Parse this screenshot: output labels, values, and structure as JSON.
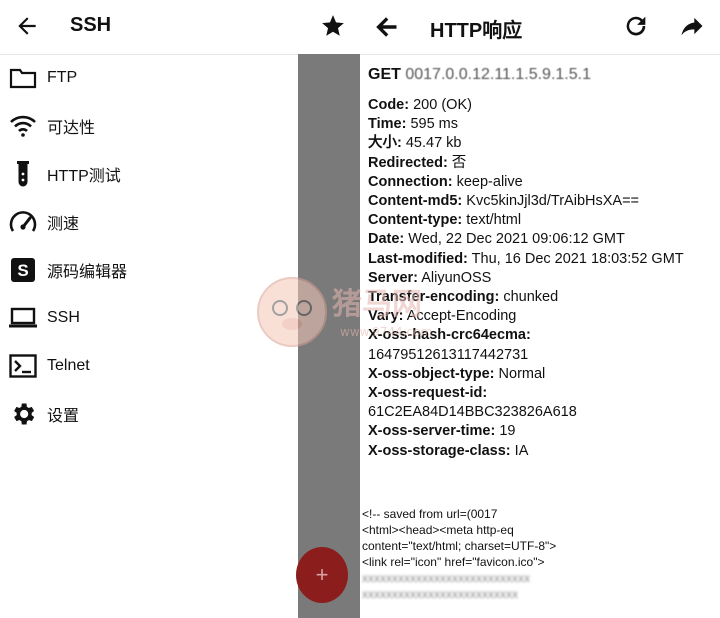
{
  "left": {
    "title": "SSH",
    "menu": [
      {
        "label": "FTP",
        "icon": "folder-icon"
      },
      {
        "label": "可达性",
        "icon": "wifi-icon"
      },
      {
        "label": "HTTP测试",
        "icon": "test-tube-icon"
      },
      {
        "label": "测速",
        "icon": "speedometer-icon"
      },
      {
        "label": "源码编辑器",
        "icon": "source-s-icon"
      },
      {
        "label": "SSH",
        "icon": "laptop-icon"
      },
      {
        "label": "Telnet",
        "icon": "terminal-icon"
      },
      {
        "label": "设置",
        "icon": "gear-icon"
      }
    ],
    "fab_label": "+"
  },
  "right": {
    "title": "HTTP响应",
    "request": {
      "method": "GET",
      "url": "0017.0.0.12.11.1.5.9.1.5.1"
    },
    "headers": [
      {
        "k": "Code:",
        "v": " 200 (OK)"
      },
      {
        "k": "Time:",
        "v": " 595 ms"
      },
      {
        "k": "大小:",
        "v": " 45.47 kb"
      },
      {
        "k": "Redirected:",
        "v": " 否"
      },
      {
        "k": "Connection:",
        "v": " keep-alive"
      },
      {
        "k": "Content-md5:",
        "v": " Kvc5kinJjl3d/TrAibHsXA=="
      },
      {
        "k": "Content-type:",
        "v": " text/html"
      },
      {
        "k": "Date:",
        "v": " Wed, 22 Dec 2021 09:06:12 GMT"
      },
      {
        "k": "Last-modified:",
        "v": " Thu, 16 Dec 2021 18:03:52 GMT"
      },
      {
        "k": "Server:",
        "v": " AliyunOSS"
      },
      {
        "k": "Transfer-encoding:",
        "v": " chunked"
      },
      {
        "k": "Vary:",
        "v": " Accept-Encoding"
      },
      {
        "k": "X-oss-hash-crc64ecma:",
        "v": ""
      },
      {
        "k": "",
        "v": "16479512613117442731"
      },
      {
        "k": "X-oss-object-type:",
        "v": " Normal"
      },
      {
        "k": "X-oss-request-id:",
        "v": ""
      },
      {
        "k": "",
        "v": "61C2EA84D14BBC323826A618"
      },
      {
        "k": "X-oss-server-time:",
        "v": " 19"
      },
      {
        "k": "X-oss-storage-class:",
        "v": " IA"
      }
    ],
    "body_lines": [
      "<!-- saved from url=(0017",
      "<html><head><meta http-eq",
      "content=\"text/html; charset=UTF-8\">",
      "<link rel=\"icon\" href=\"favicon.ico\">"
    ],
    "body_blurred": [
      "xxxxxxxxxxxxxxxxxxxxxxxxxxxx",
      "xxxxxxxxxxxxxxxxxxxxxxxxxx"
    ]
  },
  "watermark": {
    "text": "猪马网",
    "sub": "www.9744.com"
  },
  "colors": {
    "accent": "#8c1d1d",
    "strip": "#7a7a7a"
  }
}
